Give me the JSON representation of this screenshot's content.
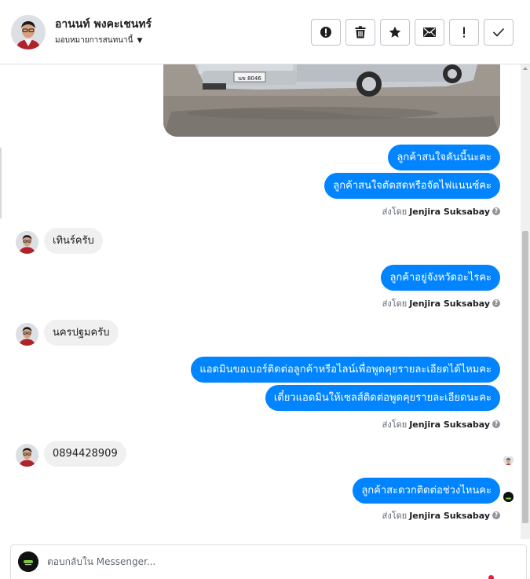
{
  "header": {
    "name": "อานนท์ พงคะเชนทร์",
    "assign_label": "มอบหมายการสนทนานี้",
    "actions": [
      {
        "icon": "alert-circle-icon",
        "name": "mark-spam-button"
      },
      {
        "icon": "trash-icon",
        "name": "delete-button"
      },
      {
        "icon": "star-icon",
        "name": "star-button"
      },
      {
        "icon": "envelope-icon",
        "name": "mark-unread-button"
      },
      {
        "icon": "exclamation-icon",
        "name": "follow-up-button"
      },
      {
        "icon": "check-icon",
        "name": "mark-done-button"
      }
    ]
  },
  "messages": {
    "out1": "ลูกค้าสนใจคันนี้นะคะ",
    "out2": "ลูกค้าสนใจตัดสดหรือจัดไฟแนนซ์คะ",
    "in1": "เทินร์ครับ",
    "out3": "ลูกค้าอยู่จังหวัดอะไรคะ",
    "in2": "นครปฐมครับ",
    "out4": "แอดมินขอเบอร์ติดต่อลูกค้าหรือไลน์เพื่อพูดคุยรายละเอียดได้ไหมคะ",
    "out5": "เดี๋ยวแอดมินให้เซลส์ติดต่อพูดคุยรายละเอียดนะคะ",
    "in3": "0894428909",
    "out6": "ลูกค้าสะดวกติดต่อช่วงไหนคะ"
  },
  "sent_by": {
    "prefix": "ส่งโดย",
    "agent": "Jenjira Suksabay"
  },
  "plate": "นข 8046",
  "composer": {
    "placeholder": "ตอบกลับใน Messenger..."
  },
  "colors": {
    "accent": "#0084ff",
    "incoming": "#f1f0f0",
    "alert": "#e41e3f"
  }
}
